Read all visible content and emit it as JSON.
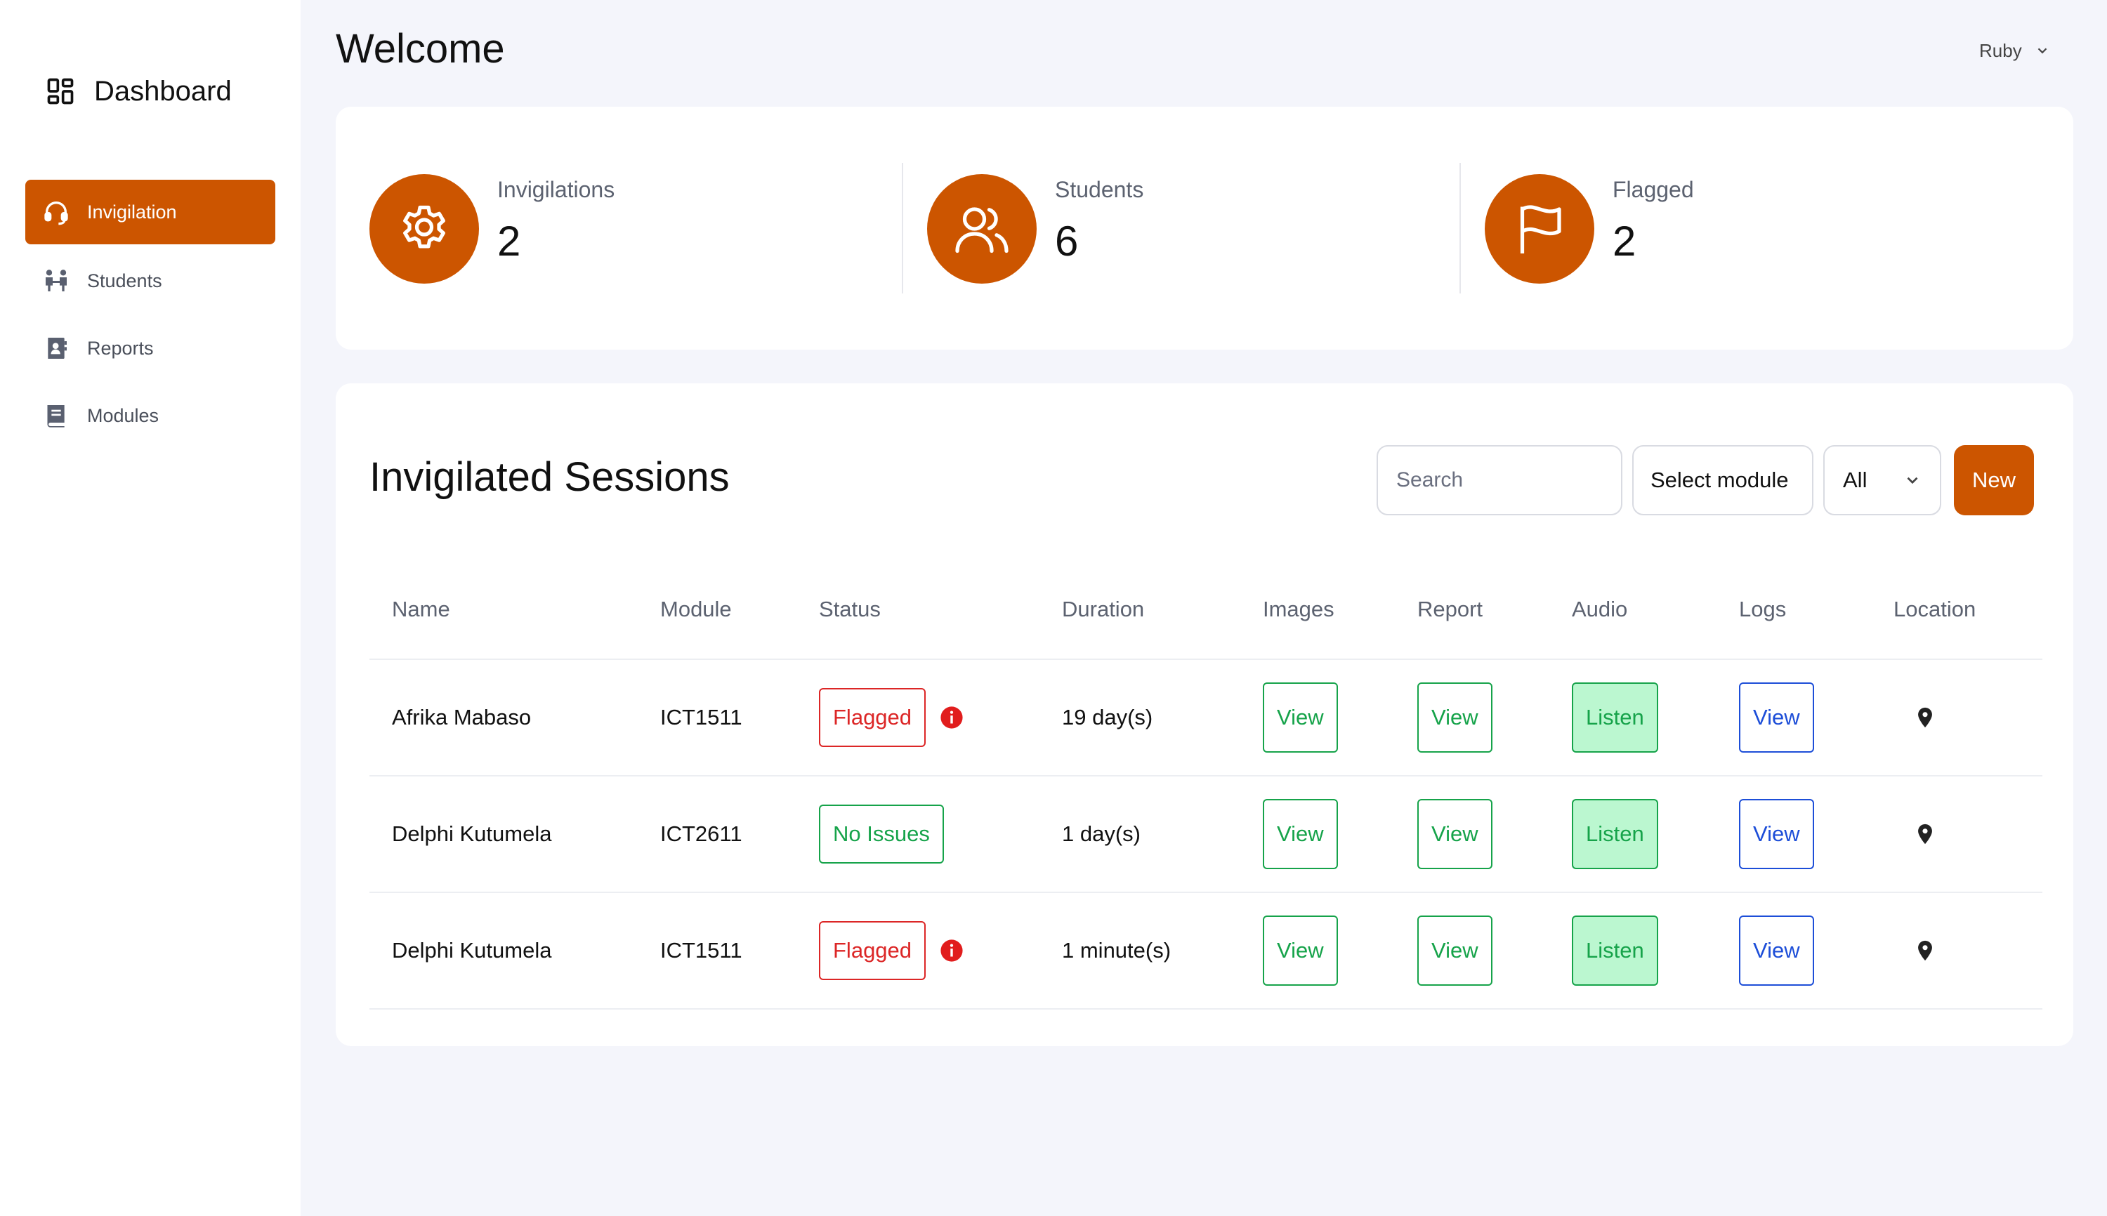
{
  "brand": {
    "label": "Dashboard",
    "icon": "dashboard-icon"
  },
  "sidebar": {
    "items": [
      {
        "label": "Invigilation",
        "icon": "headset-icon",
        "active": true
      },
      {
        "label": "Students",
        "icon": "students-icon",
        "active": false
      },
      {
        "label": "Reports",
        "icon": "reports-icon",
        "active": false
      },
      {
        "label": "Modules",
        "icon": "book-icon",
        "active": false
      }
    ]
  },
  "header": {
    "title": "Welcome",
    "user": "Ruby"
  },
  "stats": [
    {
      "label": "Invigilations",
      "value": "2",
      "icon": "gear-icon"
    },
    {
      "label": "Students",
      "value": "6",
      "icon": "users-icon"
    },
    {
      "label": "Flagged",
      "value": "2",
      "icon": "flag-icon"
    }
  ],
  "sessions": {
    "title": "Invigilated Sessions",
    "search_placeholder": "Search",
    "select_module": "Select module",
    "filter": "All",
    "new_label": "New",
    "columns": [
      "Name",
      "Module",
      "Status",
      "Duration",
      "Images",
      "Report",
      "Audio",
      "Logs",
      "Location"
    ],
    "rows": [
      {
        "name": "Afrika Mabaso",
        "module": "ICT1511",
        "status": "Flagged",
        "duration": "19 day(s)",
        "images": "View",
        "report": "View",
        "audio": "Listen",
        "logs": "View"
      },
      {
        "name": "Delphi Kutumela",
        "module": "ICT2611",
        "status": "No Issues",
        "duration": "1 day(s)",
        "images": "View",
        "report": "View",
        "audio": "Listen",
        "logs": "View"
      },
      {
        "name": "Delphi Kutumela",
        "module": "ICT1511",
        "status": "Flagged",
        "duration": "1 minute(s)",
        "images": "View",
        "report": "View",
        "audio": "Listen",
        "logs": "View"
      }
    ]
  },
  "colors": {
    "accent": "#cc5500",
    "flagged": "#dc2626",
    "ok": "#16a34a",
    "logs": "#1d4ed8",
    "listen_bg": "#bbf7d0"
  }
}
